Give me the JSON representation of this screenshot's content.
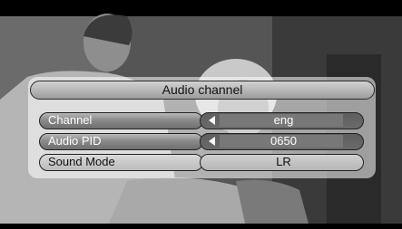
{
  "window": {
    "title": "Audio channel"
  },
  "rows": [
    {
      "label": "Channel",
      "value": "eng"
    },
    {
      "label": "Audio PID",
      "value": "0650"
    },
    {
      "label": "Sound Mode",
      "value": "LR"
    }
  ],
  "colors": {
    "overlay": "#ffffff",
    "active_bar": "#6a6a6a",
    "text_light": "#ffffff",
    "text_dark": "#111111"
  }
}
